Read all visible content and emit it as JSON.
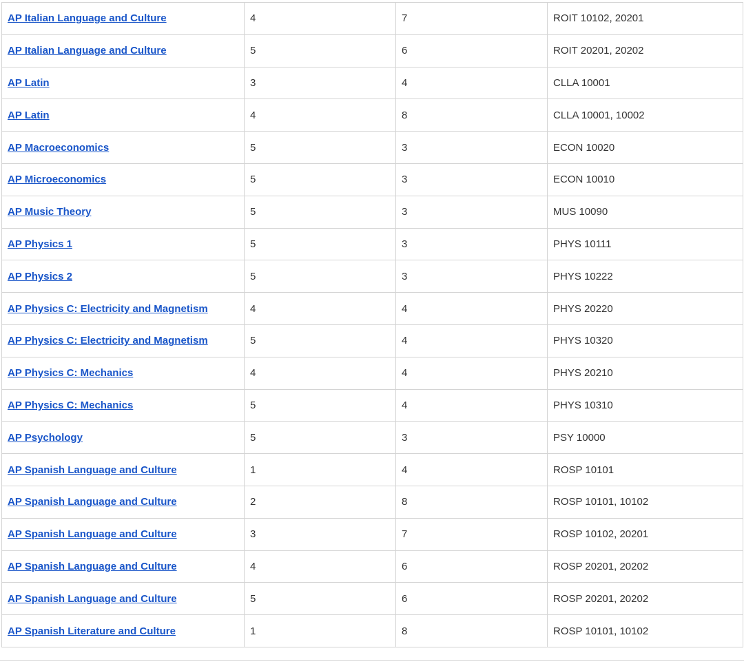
{
  "table": {
    "rows": [
      {
        "exam": "AP Italian Language and Culture",
        "score": "4",
        "credits": "7",
        "courses": "ROIT 10102, 20201"
      },
      {
        "exam": "AP Italian Language and Culture",
        "score": "5",
        "credits": "6",
        "courses": "ROIT 20201, 20202"
      },
      {
        "exam": "AP Latin",
        "score": "3",
        "credits": "4",
        "courses": "CLLA 10001"
      },
      {
        "exam": "AP Latin",
        "score": "4",
        "credits": "8",
        "courses": "CLLA 10001, 10002"
      },
      {
        "exam": "AP Macroeconomics",
        "score": "5",
        "credits": "3",
        "courses": "ECON 10020"
      },
      {
        "exam": "AP Microeconomics",
        "score": "5",
        "credits": "3",
        "courses": "ECON 10010"
      },
      {
        "exam": "AP Music Theory",
        "score": "5",
        "credits": "3",
        "courses": "MUS 10090"
      },
      {
        "exam": "AP Physics 1",
        "score": "5",
        "credits": "3",
        "courses": "PHYS 10111"
      },
      {
        "exam": "AP Physics 2",
        "score": "5",
        "credits": "3",
        "courses": "PHYS 10222"
      },
      {
        "exam": "AP Physics C: Electricity and Magnetism",
        "score": "4",
        "credits": "4",
        "courses": "PHYS 20220"
      },
      {
        "exam": "AP Physics C: Electricity and Magnetism",
        "score": "5",
        "credits": "4",
        "courses": "PHYS 10320"
      },
      {
        "exam": "AP Physics C: Mechanics",
        "score": "4",
        "credits": "4",
        "courses": "PHYS 20210"
      },
      {
        "exam": "AP Physics C: Mechanics",
        "score": "5",
        "credits": "4",
        "courses": "PHYS 10310"
      },
      {
        "exam": "AP Psychology",
        "score": "5",
        "credits": "3",
        "courses": "PSY 10000"
      },
      {
        "exam": "AP Spanish Language and Culture",
        "score": "1",
        "credits": "4",
        "courses": "ROSP 10101"
      },
      {
        "exam": "AP Spanish Language and Culture",
        "score": "2",
        "credits": "8",
        "courses": "ROSP 10101, 10102"
      },
      {
        "exam": "AP Spanish Language and Culture",
        "score": "3",
        "credits": "7",
        "courses": "ROSP 10102, 20201"
      },
      {
        "exam": "AP Spanish Language and Culture",
        "score": "4",
        "credits": "6",
        "courses": "ROSP 20201, 20202"
      },
      {
        "exam": "AP Spanish Language and Culture",
        "score": "5",
        "credits": "6",
        "courses": "ROSP 20201, 20202"
      },
      {
        "exam": "AP Spanish Literature and Culture",
        "score": "1",
        "credits": "8",
        "courses": "ROSP 10101, 10102"
      }
    ]
  },
  "colors": {
    "link": "#1a56c9",
    "text": "#333333",
    "border": "#d4d4d4"
  }
}
